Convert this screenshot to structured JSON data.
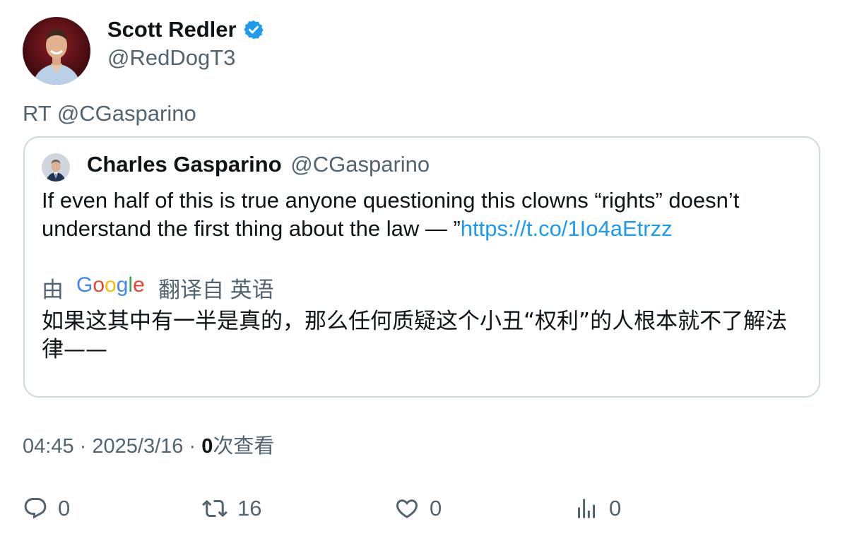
{
  "tweet": {
    "author_name": "Scott Redler",
    "handle": "@RedDogT3",
    "text": "RT @CGasparino"
  },
  "quoted": {
    "author_name": "Charles Gasparino",
    "handle": "@CGasparino",
    "text": "If even half of this is true anyone questioning this clowns “rights” doesn’t understand the first thing about the law — ”",
    "link": "https://t.co/1Io4aEtrzz",
    "translate_prefix": "由",
    "translate_suffix": "翻译自 英语",
    "translated_text": "如果这其中有一半是真的，那么任何质疑这个小丑“权利”的人根本就不了解法律——"
  },
  "meta": {
    "time": "04:45",
    "separator": "·",
    "date": "2025/3/16",
    "views_count": "0",
    "views_label": "次查看"
  },
  "actions": {
    "replies": "0",
    "retweets": "16",
    "likes": "0",
    "views": "0"
  },
  "colors": {
    "verified": "#1d9bf0",
    "link": "#1d9bf0",
    "secondary_text": "#536471",
    "card_border": "#cfd9de"
  },
  "icons": [
    "verified-badge-icon",
    "google-logo",
    "reply-icon",
    "retweet-icon",
    "like-icon",
    "views-icon"
  ]
}
